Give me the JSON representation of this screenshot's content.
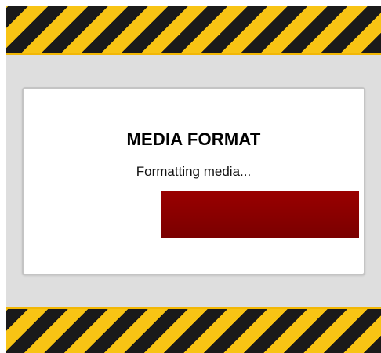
{
  "dialog": {
    "title": "MEDIA FORMAT",
    "message": "Formatting media..."
  },
  "progress": {
    "fraction": 0.59,
    "fill_color": "#8b0000",
    "fill_direction": "right-to-left"
  },
  "theme": {
    "hazard_black": "#1a1a1a",
    "hazard_yellow": "#f8c414",
    "background": "#dedede"
  }
}
